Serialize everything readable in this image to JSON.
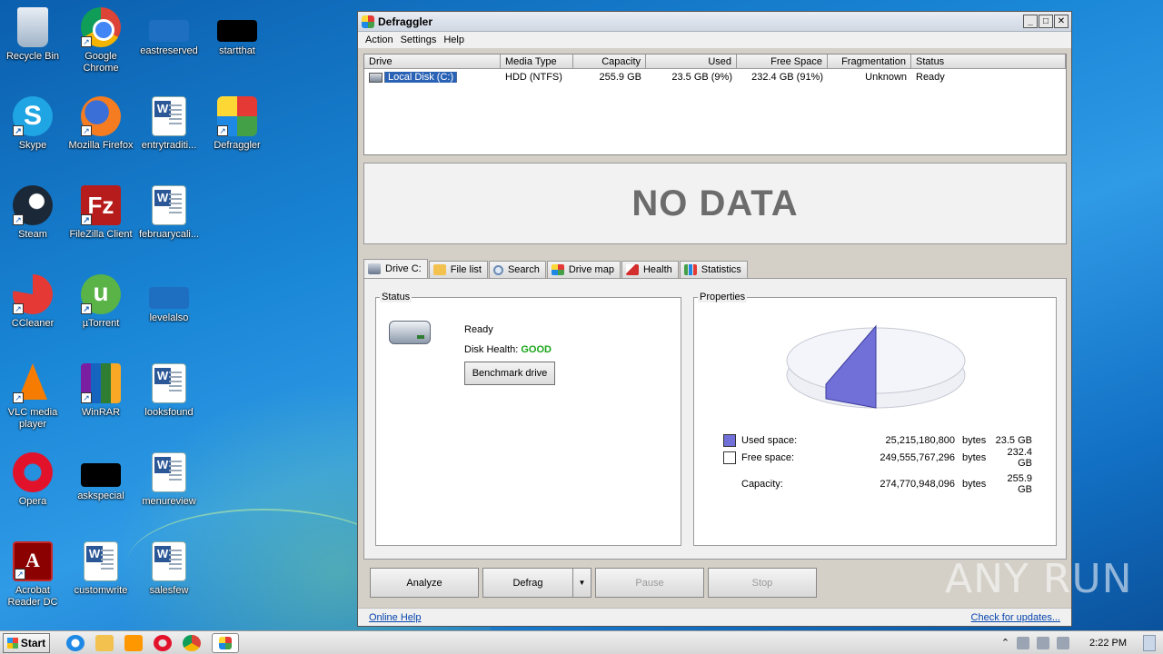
{
  "desktop": {
    "icons": [
      {
        "label": "Recycle Bin"
      },
      {
        "label": "Google Chrome"
      },
      {
        "label": "eastreserved"
      },
      {
        "label": "startthat"
      },
      {
        "label": "Skype"
      },
      {
        "label": "Mozilla Firefox"
      },
      {
        "label": "entrytraditi..."
      },
      {
        "label": "Defraggler"
      },
      {
        "label": "Steam"
      },
      {
        "label": "FileZilla Client"
      },
      {
        "label": "februarycali..."
      },
      {
        "label": "CCleaner"
      },
      {
        "label": "µTorrent"
      },
      {
        "label": "levelalso"
      },
      {
        "label": "VLC media player"
      },
      {
        "label": "WinRAR"
      },
      {
        "label": "looksfound"
      },
      {
        "label": "Opera"
      },
      {
        "label": "askspecial"
      },
      {
        "label": "menureview"
      },
      {
        "label": "Acrobat Reader DC"
      },
      {
        "label": "customwrite"
      },
      {
        "label": "salesfew"
      }
    ]
  },
  "window": {
    "title": "Defraggler",
    "menu": [
      "Action",
      "Settings",
      "Help"
    ],
    "drive_table": {
      "columns": [
        "Drive",
        "Media Type",
        "Capacity",
        "Used",
        "Free Space",
        "Fragmentation",
        "Status"
      ],
      "rows": [
        {
          "drive": "Local Disk (C:)",
          "media": "HDD (NTFS)",
          "capacity": "255.9 GB",
          "used": "23.5 GB (9%)",
          "free": "232.4 GB (91%)",
          "fragmentation": "Unknown",
          "status": "Ready"
        }
      ]
    },
    "drive_map_text": "NO DATA",
    "tabs": [
      "Drive C:",
      "File list",
      "Search",
      "Drive map",
      "Health",
      "Statistics"
    ],
    "status_group": {
      "legend": "Status",
      "state": "Ready",
      "health_label": "Disk Health:",
      "health_value": "GOOD",
      "benchmark_button": "Benchmark drive"
    },
    "properties_group": {
      "legend": "Properties",
      "used_label": "Used space:",
      "used_bytes": "25,215,180,800",
      "used_unit": "bytes",
      "used_gb": "23.5 GB",
      "free_label": "Free space:",
      "free_bytes": "249,555,767,296",
      "free_unit": "bytes",
      "free_gb": "232.4 GB",
      "capacity_label": "Capacity:",
      "capacity_bytes": "274,770,948,096",
      "capacity_unit": "bytes",
      "capacity_gb": "255.9 GB",
      "used_fraction": 0.092,
      "used_color": "#7070d8",
      "free_color": "#ffffff"
    },
    "buttons": {
      "analyze": "Analyze",
      "defrag": "Defrag",
      "pause": "Pause",
      "stop": "Stop"
    },
    "footer": {
      "online_help": "Online Help",
      "check_updates": "Check for updates..."
    }
  },
  "watermark": "ANY RUN",
  "taskbar": {
    "start": "Start",
    "clock": "2:22 PM"
  }
}
